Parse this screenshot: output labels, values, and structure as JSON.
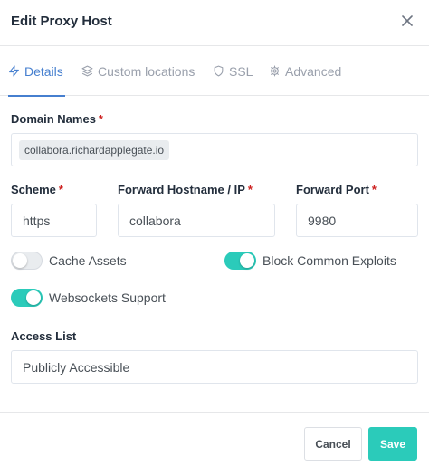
{
  "modal": {
    "title": "Edit Proxy Host"
  },
  "tabs": [
    {
      "label": "Details",
      "icon": "lightning-icon",
      "active": true
    },
    {
      "label": "Custom locations",
      "icon": "layers-icon",
      "active": false
    },
    {
      "label": "SSL",
      "icon": "shield-icon",
      "active": false
    },
    {
      "label": "Advanced",
      "icon": "gear-icon",
      "active": false
    }
  ],
  "form": {
    "domain_names": {
      "label": "Domain Names",
      "required": "*",
      "values": [
        "collabora.richardapplegate.io"
      ]
    },
    "scheme": {
      "label": "Scheme",
      "required": "*",
      "value": "https"
    },
    "forward_hostname": {
      "label": "Forward Hostname / IP",
      "required": "*",
      "value": "collabora"
    },
    "forward_port": {
      "label": "Forward Port",
      "required": "*",
      "value": "9980"
    },
    "cache_assets": {
      "label": "Cache Assets",
      "enabled": false
    },
    "block_common_exploits": {
      "label": "Block Common Exploits",
      "enabled": true
    },
    "websockets_support": {
      "label": "Websockets Support",
      "enabled": true
    },
    "access_list": {
      "label": "Access List",
      "value": "Publicly Accessible"
    }
  },
  "footer": {
    "cancel_label": "Cancel",
    "save_label": "Save"
  },
  "colors": {
    "accent": "#467fcf",
    "toggle_on": "#2bcbba",
    "save_button": "#2bcbba",
    "required": "#cd201f"
  }
}
